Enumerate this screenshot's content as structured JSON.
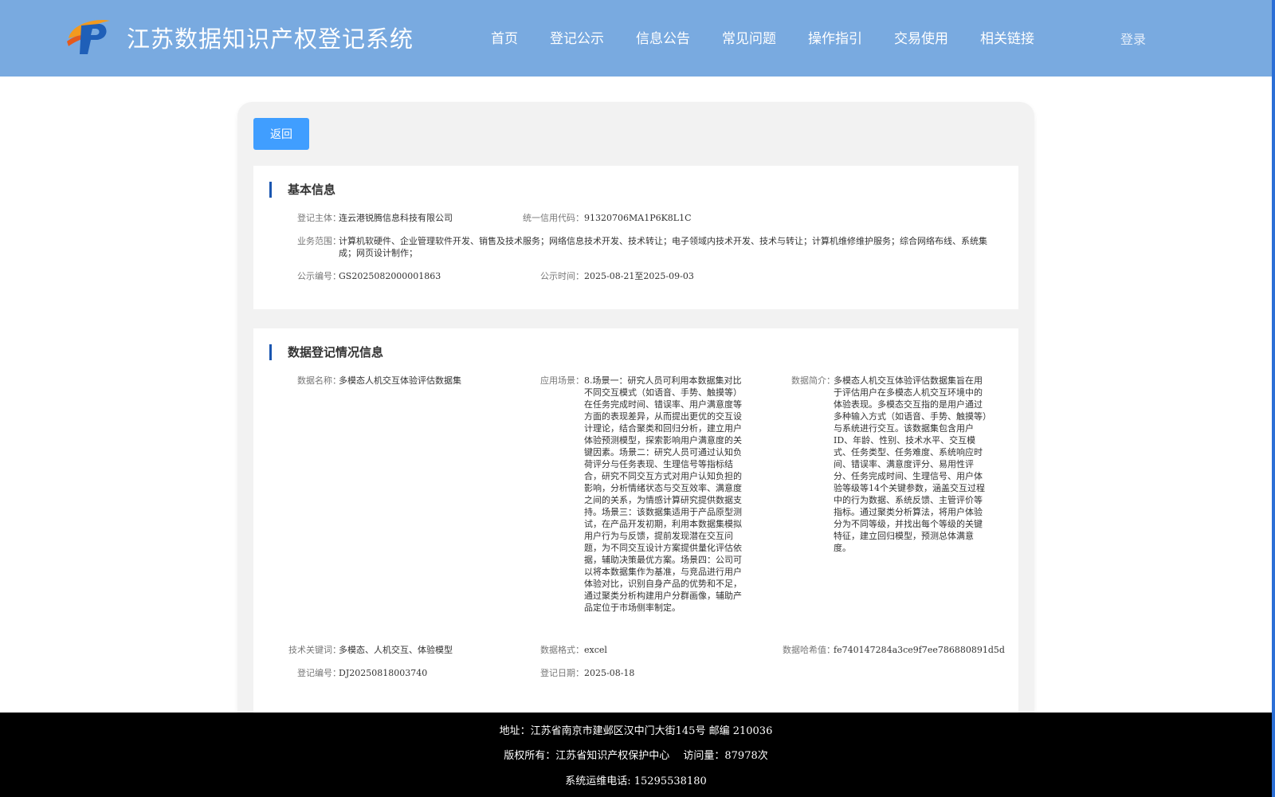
{
  "header": {
    "title": "江苏数据知识产权登记系统",
    "nav": [
      "首页",
      "登记公示",
      "信息公告",
      "常见问题",
      "操作指引",
      "交易使用",
      "相关链接"
    ],
    "login": "登录"
  },
  "back_button": "返回",
  "basic": {
    "title": "基本信息",
    "subject_label": "登记主体：",
    "subject": "连云港锐腾信息科技有限公司",
    "credit_label": "统一信用代码：",
    "credit": "91320706MA1P6K8L1C",
    "scope_label": "业务范围：",
    "scope": "计算机软硬件、企业管理软件开发、销售及技术服务；网络信息技术开发、技术转让；电子领域内技术开发、技术与转让；计算机维修维护服务；综合网络布线、系统集成；网页设计制作；",
    "pub_no_label": "公示编号：",
    "pub_no": "GS2025082000001863",
    "pub_time_label": "公示时间：",
    "pub_time": "2025-08-21至2025-09-03"
  },
  "registration": {
    "title": "数据登记情况信息",
    "name_label": "数据名称：",
    "name": "多模态人机交互体验评估数据集",
    "scene_label": "应用场景：",
    "scene": "8.场景一：研究人员可利用本数据集对比不同交互模式（如语音、手势、触摸等）在任务完成时间、错误率、用户满意度等方面的表现差异，从而提出更优的交互设计理论，结合聚类和回归分析，建立用户体验预测模型，探索影响用户满意度的关键因素。场景二：研究人员可通过认知负荷评分与任务表现、生理信号等指标结合，研究不同交互方式对用户认知负担的影响，分析情绪状态与交互效率、满意度之间的关系，为情感计算研究提供数据支持。场景三：该数据集适用于产品原型测试，在产品开发初期，利用本数据集模拟用户行为与反馈，提前发现潜在交互问题，为不同交互设计方案提供量化评估依据，辅助决策最优方案。场景四：公司可以将本数据集作为基准，与竞品进行用户体验对比，识别自身产品的优势和不足，通过聚类分析构建用户分群画像，辅助产品定位于市场侧率制定。",
    "intro_label": "数据简介：",
    "intro": "多模态人机交互体验评估数据集旨在用于评估用户在多模态人机交互环境中的体验表现。多模态交互指的是用户通过多种输入方式（如语音、手势、触摸等）与系统进行交互。该数据集包含用户ID、年龄、性别、技术水平、交互模式、任务类型、任务难度、系统响应时间、错误率、满意度评分、易用性评分、任务完成时间、生理信号、用户体验等级等14个关键参数，涵盖交互过程中的行为数据、系统反馈、主管评价等指标。通过聚类分析算法，将用户体验分为不同等级，并找出每个等级的关键特征，建立回归模型，预测总体满意度。",
    "keywords_label": "技术关键词：",
    "keywords": "多模态、人机交互、体验模型",
    "format_label": "数据格式：",
    "format": "excel",
    "hash_label": "数据哈希值：",
    "hash": "fe740147284a3ce9f7ee786880891d5d",
    "reg_no_label": "登记编号：",
    "reg_no": "DJ20250818003740",
    "reg_date_label": "登记日期：",
    "reg_date": "2025-08-18"
  },
  "footer": {
    "address": "地址：江苏省南京市建邺区汉中门大街145号 邮编 210036",
    "copyright": "版权所有：江苏省知识产权保护中心　 访问量：87978次",
    "phone": "系统运维电话: 15295538180"
  },
  "colors": {
    "header_bg": "#79aae0",
    "button_blue": "#409eff",
    "title_bar": "#1a56b0",
    "footer_bg": "#000000"
  },
  "icons": {
    "logo": "logo-icon"
  }
}
